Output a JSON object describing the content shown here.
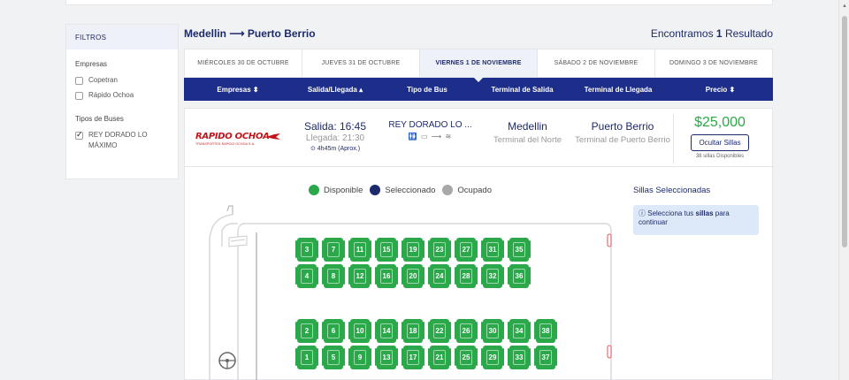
{
  "filters": {
    "title": "FILTROS",
    "empresas_label": "Empresas",
    "empresas": [
      {
        "label": "Copetran",
        "checked": false
      },
      {
        "label": "Rápido Ochoa",
        "checked": false
      }
    ],
    "tipos_label": "Tipos de Buses",
    "tipos": [
      {
        "label": "REY DORADO LO MÁXIMO",
        "checked": true
      }
    ]
  },
  "route": {
    "text": "Medellin ⟶ Puerto Berrio",
    "results_prefix": "Encontramos",
    "results_count": "1",
    "results_suffix": "Resultado"
  },
  "date_tabs": [
    {
      "label": "MIÉRCOLES 30 DE OCTUBRE",
      "active": false
    },
    {
      "label": "JUEVES 31 DE OCTUBRE",
      "active": false
    },
    {
      "label": "VIERNES 1 DE NOVIEMBRE",
      "active": true
    },
    {
      "label": "SÁBADO 2 DE NOVIEMBRE",
      "active": false
    },
    {
      "label": "DOMINGO 3 DE NOVIEMBRE",
      "active": false
    }
  ],
  "columns": {
    "empresas": "Empresas ⬍",
    "salida": "Salida/Llegada ▴",
    "tipo": "Tipo de Bus",
    "terminal_salida": "Terminal de Salida",
    "terminal_llegada": "Terminal de Llegada",
    "precio": "Precio ⬍"
  },
  "trip": {
    "company_logo": "RAPIDO OCHOA",
    "company_sub": "TRANSPORTES RAPIDO OCHOA S.A.",
    "salida": "Salida: 16:45",
    "llegada": "Llegada: 21:30",
    "duration": "⊙ 4h45m (Aprox.)",
    "bus_type": "REY DORADO LO ...",
    "amenities": "🚻 ▭ ⟿ ≋",
    "origin_city": "Medellin",
    "origin_terminal": "Terminal del Norte",
    "dest_city": "Puerto Berrio",
    "dest_terminal": "Terminal de Puerto Berrio",
    "price": "$25,000",
    "hide_seats_label": "Ocultar Sillas",
    "seats_available": "38 sillas Disponibles"
  },
  "legend": {
    "available": "Disponible",
    "selected": "Seleccionado",
    "occupied": "Ocupado",
    "available_color": "#2aa84a",
    "selected_color": "#1d2a6b",
    "occupied_color": "#a8a8a8"
  },
  "selected_panel": {
    "title": "Sillas Seleccionadas",
    "info_prefix": "Selecciona tus ",
    "info_bold": "sillas",
    "info_suffix": " para continuar"
  },
  "seats": {
    "row_top_1": [
      "3",
      "7",
      "11",
      "15",
      "19",
      "23",
      "27",
      "31",
      "35"
    ],
    "row_top_2": [
      "4",
      "8",
      "12",
      "16",
      "20",
      "24",
      "28",
      "32",
      "36"
    ],
    "row_bottom_1": [
      "2",
      "6",
      "10",
      "14",
      "18",
      "22",
      "26",
      "30",
      "34",
      "38"
    ],
    "row_bottom_2": [
      "1",
      "5",
      "9",
      "13",
      "17",
      "21",
      "25",
      "29",
      "33",
      "37"
    ]
  }
}
